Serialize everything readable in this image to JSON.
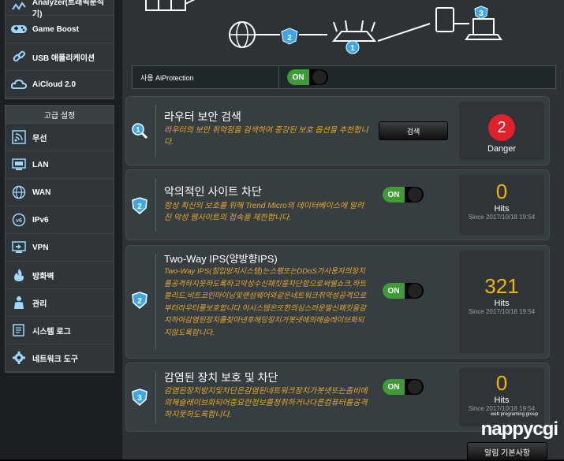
{
  "sidebar": {
    "top_items": [
      {
        "label": "Analyzer(트래픽분석기)",
        "icon": "traffic-analyzer-icon"
      },
      {
        "label": "Game Boost",
        "icon": "gamepad-icon"
      },
      {
        "label": "USB 애플리케이션",
        "icon": "usb-link-icon"
      },
      {
        "label": "AiCloud 2.0",
        "icon": "cloud-icon"
      }
    ],
    "advanced_heading": "고급 설정",
    "advanced_items": [
      {
        "label": "무선",
        "icon": "wireless-icon"
      },
      {
        "label": "LAN",
        "icon": "lan-icon"
      },
      {
        "label": "WAN",
        "icon": "globe-icon"
      },
      {
        "label": "IPv6",
        "icon": "ipv6-icon"
      },
      {
        "label": "VPN",
        "icon": "vpn-icon"
      },
      {
        "label": "방화벽",
        "icon": "firewall-icon"
      },
      {
        "label": "관리",
        "icon": "admin-icon"
      },
      {
        "label": "시스템 로그",
        "icon": "system-log-icon"
      },
      {
        "label": "네트워크 도구",
        "icon": "network-tools-icon"
      }
    ]
  },
  "diagram": {
    "steps": [
      "1",
      "2",
      "3"
    ]
  },
  "aiprotection": {
    "label": "사용 AiProtection",
    "toggle": "ON"
  },
  "cards": {
    "scan": {
      "title": "라우터 보안 검색",
      "desc": "라우터의 보안 취약점을 검색하여 중강된 보호 옵션을 추천합니다.",
      "button": "검색",
      "count": "2",
      "status": "Danger"
    },
    "malicious": {
      "title": "악의적인 사이트 차단",
      "desc": "항상 최신의 보호를 위해 Trend Micro의 데이터베이스에 알려진 악성 웹사이트의 접속을 제한합니다.",
      "toggle": "ON",
      "count": "0",
      "unit": "Hits",
      "since": "Since 2017/10/18 19:54"
    },
    "ips": {
      "title": "Two-Way IPS(양방향IPS)",
      "desc": "Two-Way IPS(침입방지시스템)는스팸또는DDoS가사용자의장치를공격하지못하도록하고악성수신패킷을차단합으로써쉘쇼크,하트블리드,비트코인마이닝및랜섬웨어와같은네트워크취약성공격으로부터라우터를보호합니다.이시스템은또한의심스러운발신패킷을감지하여감염된장치를찾아낸후해당장치가봇넷에의해슬레이브화되지않도록합니다.",
      "toggle": "ON",
      "count": "321",
      "unit": "Hits",
      "since": "Since 2017/10/18 19:54"
    },
    "infected": {
      "title": "감염된 장치 보호 및 차단",
      "desc": "감염된장치방지및차단은감염된네트워크장치가봇넷또는좀비에의해슬레이브화되어중요한정보를정취하거나다른컴퓨터를공격하지못하도록합니다.",
      "toggle": "ON",
      "count": "0",
      "unit": "Hits",
      "since": "Since 2017/10/18 19:54"
    }
  },
  "bottom_button": "알림 기본사항",
  "watermark": {
    "text": "nappycgi",
    "sub": "web programing group"
  },
  "colors": {
    "accent_orange": "#f4b400",
    "danger_red": "#e0202a",
    "toggle_green": "#3f9a38"
  }
}
